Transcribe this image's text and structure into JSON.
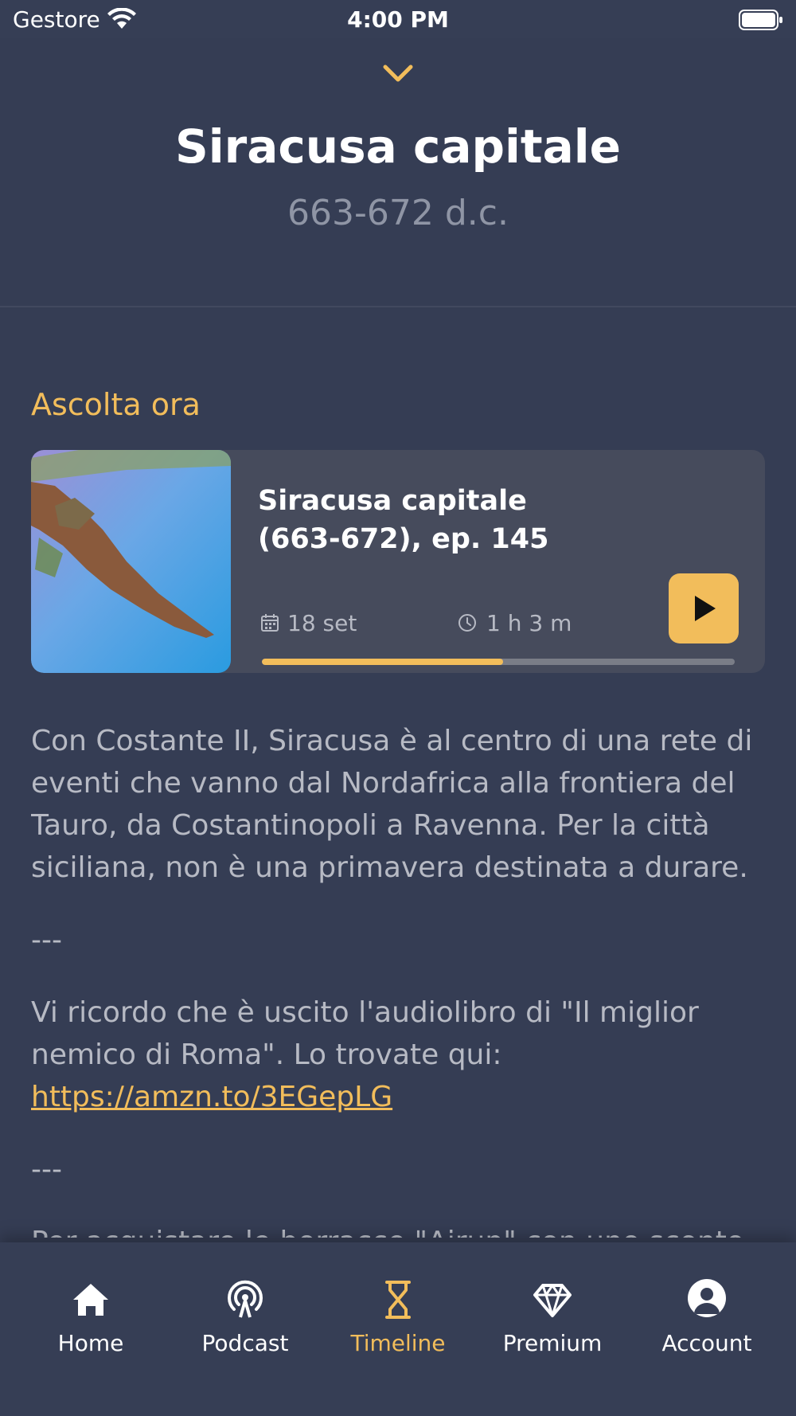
{
  "status_bar": {
    "carrier": "Gestore",
    "time": "4:00 PM"
  },
  "header": {
    "title": "Siracusa capitale",
    "subtitle": "663-672 d.c."
  },
  "listen": {
    "section_title": "Ascolta ora",
    "episode": {
      "title": "Siracusa capitale (663-672), ep. 145",
      "date": "18 set",
      "duration": "1 h 3 m",
      "progress_percent": 51
    }
  },
  "description": {
    "paragraph1": "Con Costante II, Siracusa è al centro di una rete di eventi che vanno dal Nordafrica alla frontiera del Tauro, da Costantinopoli a Ravenna. Per la città siciliana, non è una primavera destinata a durare.",
    "separator1": "---",
    "paragraph2": "Vi ricordo che è uscito l'audiolibro di \"Il miglior nemico di Roma\". Lo trovate qui:",
    "link": "https://amzn.to/3EGepLG",
    "separator2": "---",
    "paragraph3": "Per acquistare le borracce \"Airup\" con uno sconto"
  },
  "tabs": [
    {
      "label": "Home",
      "icon": "home-icon"
    },
    {
      "label": "Podcast",
      "icon": "podcast-icon"
    },
    {
      "label": "Timeline",
      "icon": "hourglass-icon",
      "active": true
    },
    {
      "label": "Premium",
      "icon": "diamond-icon"
    },
    {
      "label": "Account",
      "icon": "account-icon"
    }
  ],
  "colors": {
    "background": "#353d54",
    "accent": "#f2bd5b",
    "card": "#464b5c",
    "muted_text": "#b7bac4"
  }
}
